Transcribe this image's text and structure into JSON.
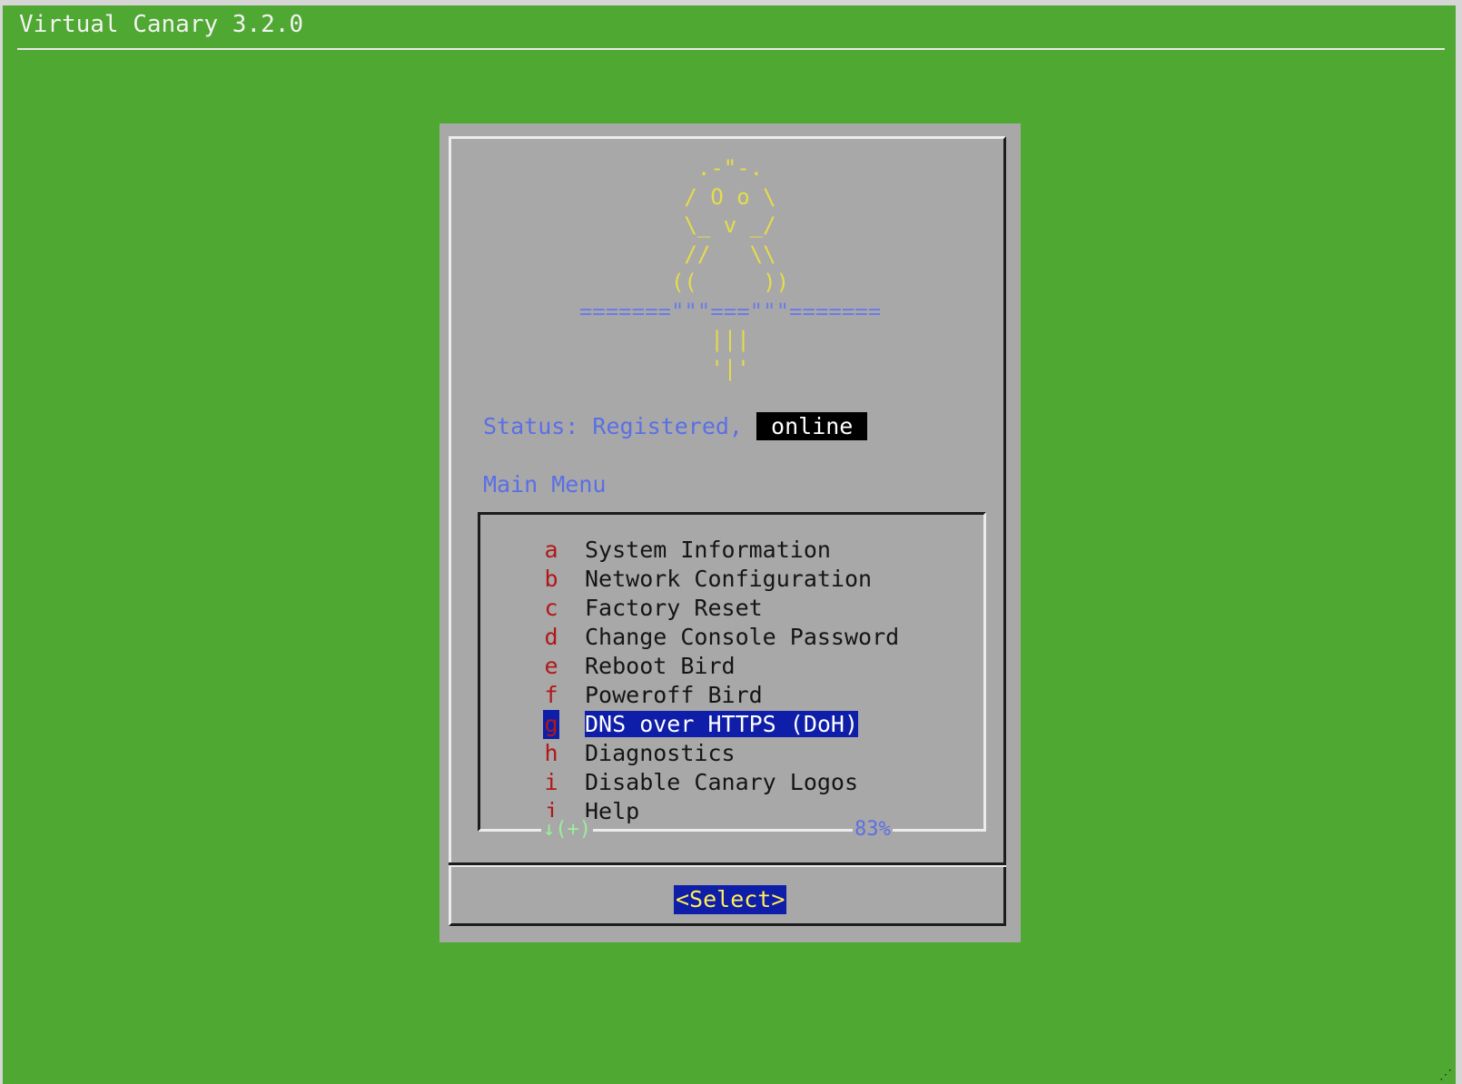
{
  "window": {
    "title": "Virtual Canary 3.2.0"
  },
  "dialog": {
    "ascii_art": [
      "    .-\"-.    ",
      "   / O o \\   ",
      "   \\_ v _/   ",
      "   //   \\\\   ",
      "  ((     ))  ",
      "=======\"\"\"===\"\"\"=======",
      "   |||   ",
      "   '|'   "
    ],
    "status": {
      "label": "Status: Registered,",
      "state": "online"
    },
    "menu": {
      "title": "Main Menu",
      "items": [
        {
          "key": "a",
          "label": "System Information"
        },
        {
          "key": "b",
          "label": "Network Configuration"
        },
        {
          "key": "c",
          "label": "Factory Reset"
        },
        {
          "key": "d",
          "label": "Change Console Password"
        },
        {
          "key": "e",
          "label": "Reboot Bird"
        },
        {
          "key": "f",
          "label": "Poweroff Bird"
        },
        {
          "key": "g",
          "label": "DNS over HTTPS (DoH)"
        },
        {
          "key": "h",
          "label": "Diagnostics"
        },
        {
          "key": "i",
          "label": "Disable Canary Logos"
        },
        {
          "key": "j",
          "label": "Help"
        }
      ],
      "selected_key": "g",
      "scroll_indicator": "↓(+)",
      "scroll_percent": "83%"
    },
    "select_button": "<Select>"
  },
  "colors": {
    "background": "#4fa832",
    "dialog": "#a8a8a8",
    "highlight": "#0f1ea8",
    "hotkey": "#b01818",
    "accent_text": "#5a6fe6",
    "ascii_art": "#e6dc4a"
  }
}
